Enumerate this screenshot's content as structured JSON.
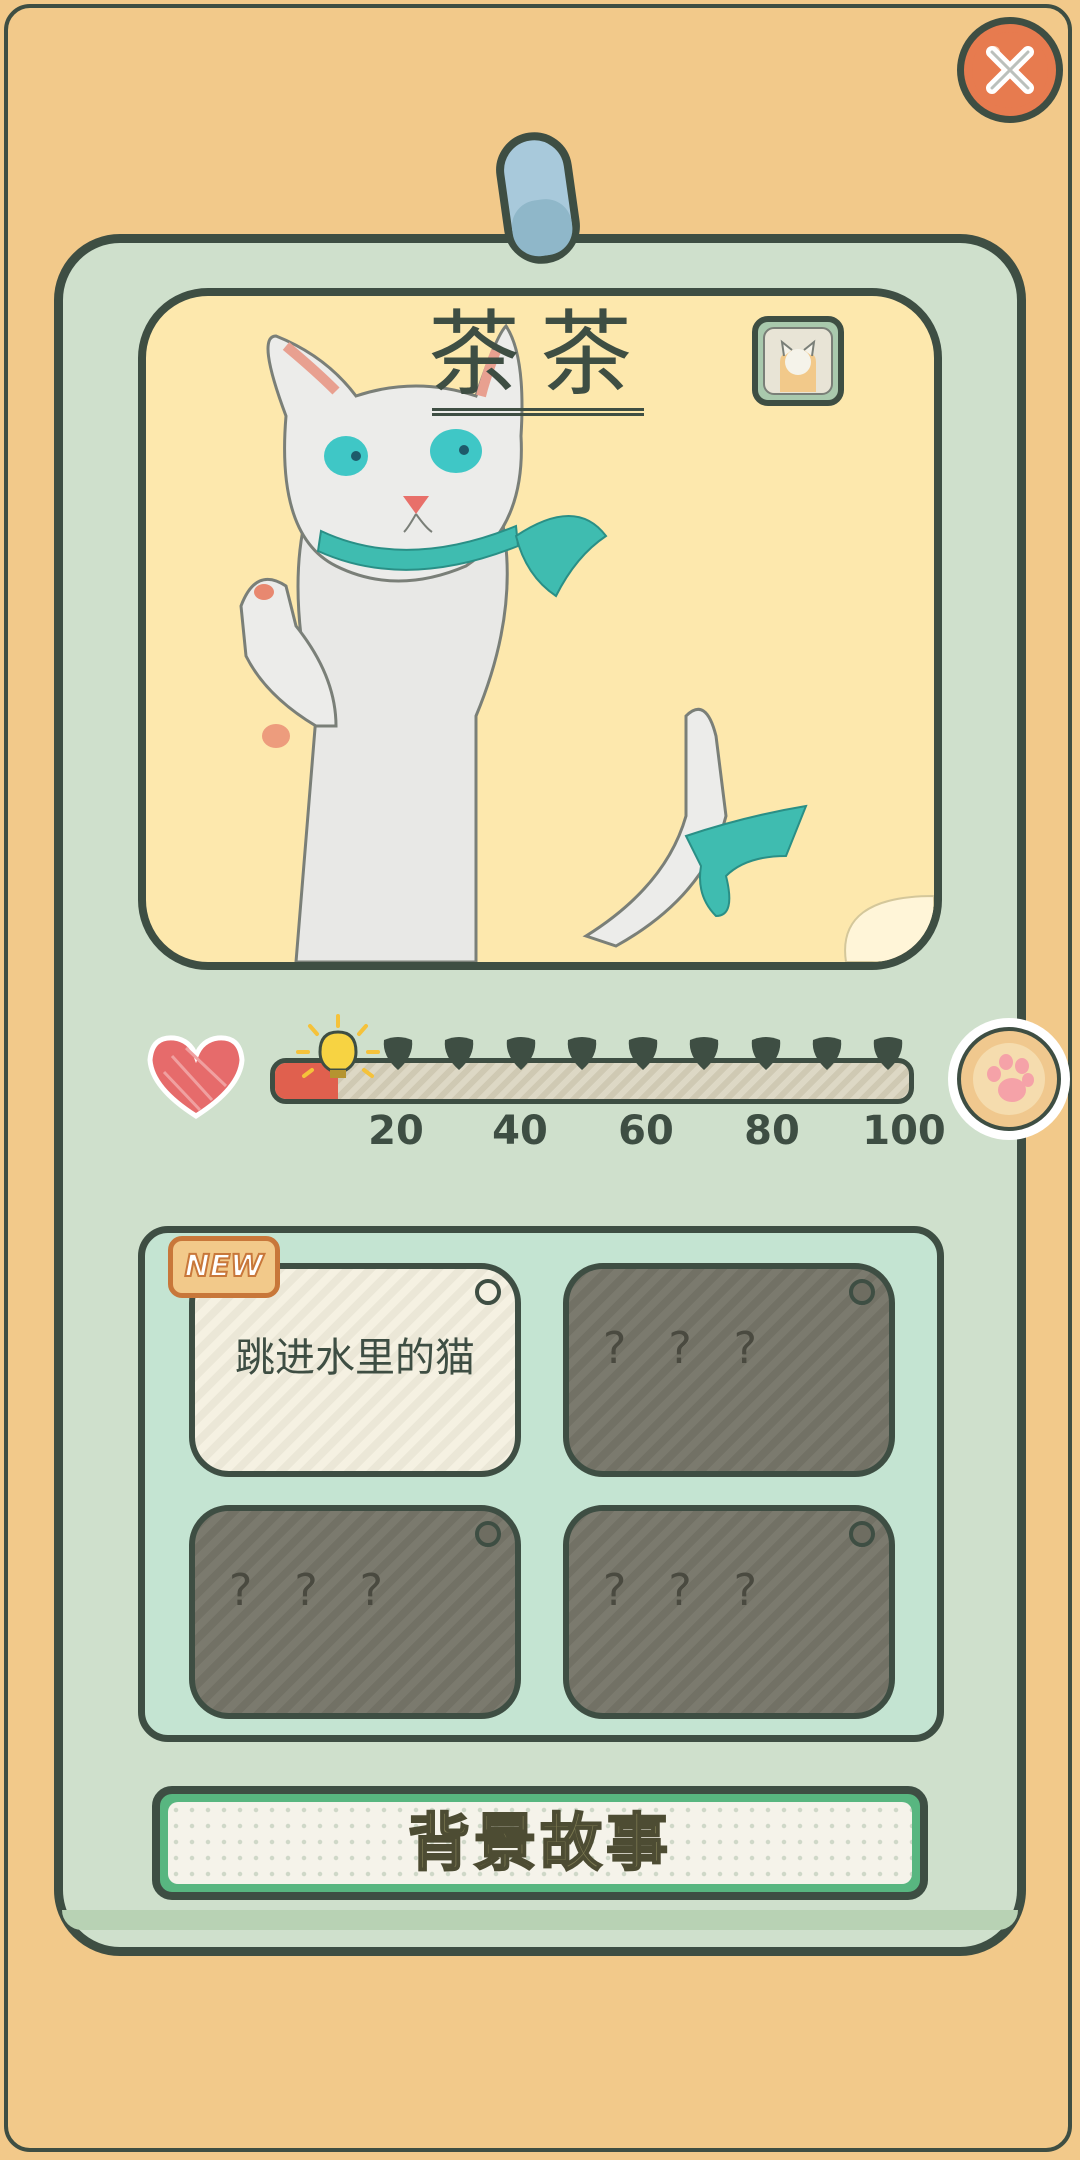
{
  "character": {
    "name": "茶茶",
    "portrait_icon": "white-cat-with-teal-ribbon"
  },
  "affection": {
    "icon": "heart-icon",
    "progress_fraction": 0.1,
    "max": 100,
    "ticks": [
      "20",
      "40",
      "60",
      "80",
      "100"
    ],
    "milestone_count": 9,
    "colors": {
      "fill": "#e0604e",
      "milestone": "#3e4e43"
    }
  },
  "stories": {
    "new_badge": "NEW",
    "items": [
      {
        "title": "跳进水里的猫",
        "unlocked": true
      },
      {
        "title": "? ? ?",
        "unlocked": false
      },
      {
        "title": "? ? ?",
        "unlocked": false
      },
      {
        "title": "? ? ?",
        "unlocked": false
      }
    ]
  },
  "buttons": {
    "backstory": "背景故事",
    "close_icon": "close-icon",
    "paw_icon": "paw-icon",
    "avatar_icon": "cat-avatar-icon"
  },
  "colors": {
    "background": "#f2c98a",
    "card": "#cfe0cc",
    "portrait_bg": "#fde8ad",
    "outline": "#3e4e43",
    "accent_green": "#58b680",
    "close_red": "#e77b4f"
  }
}
